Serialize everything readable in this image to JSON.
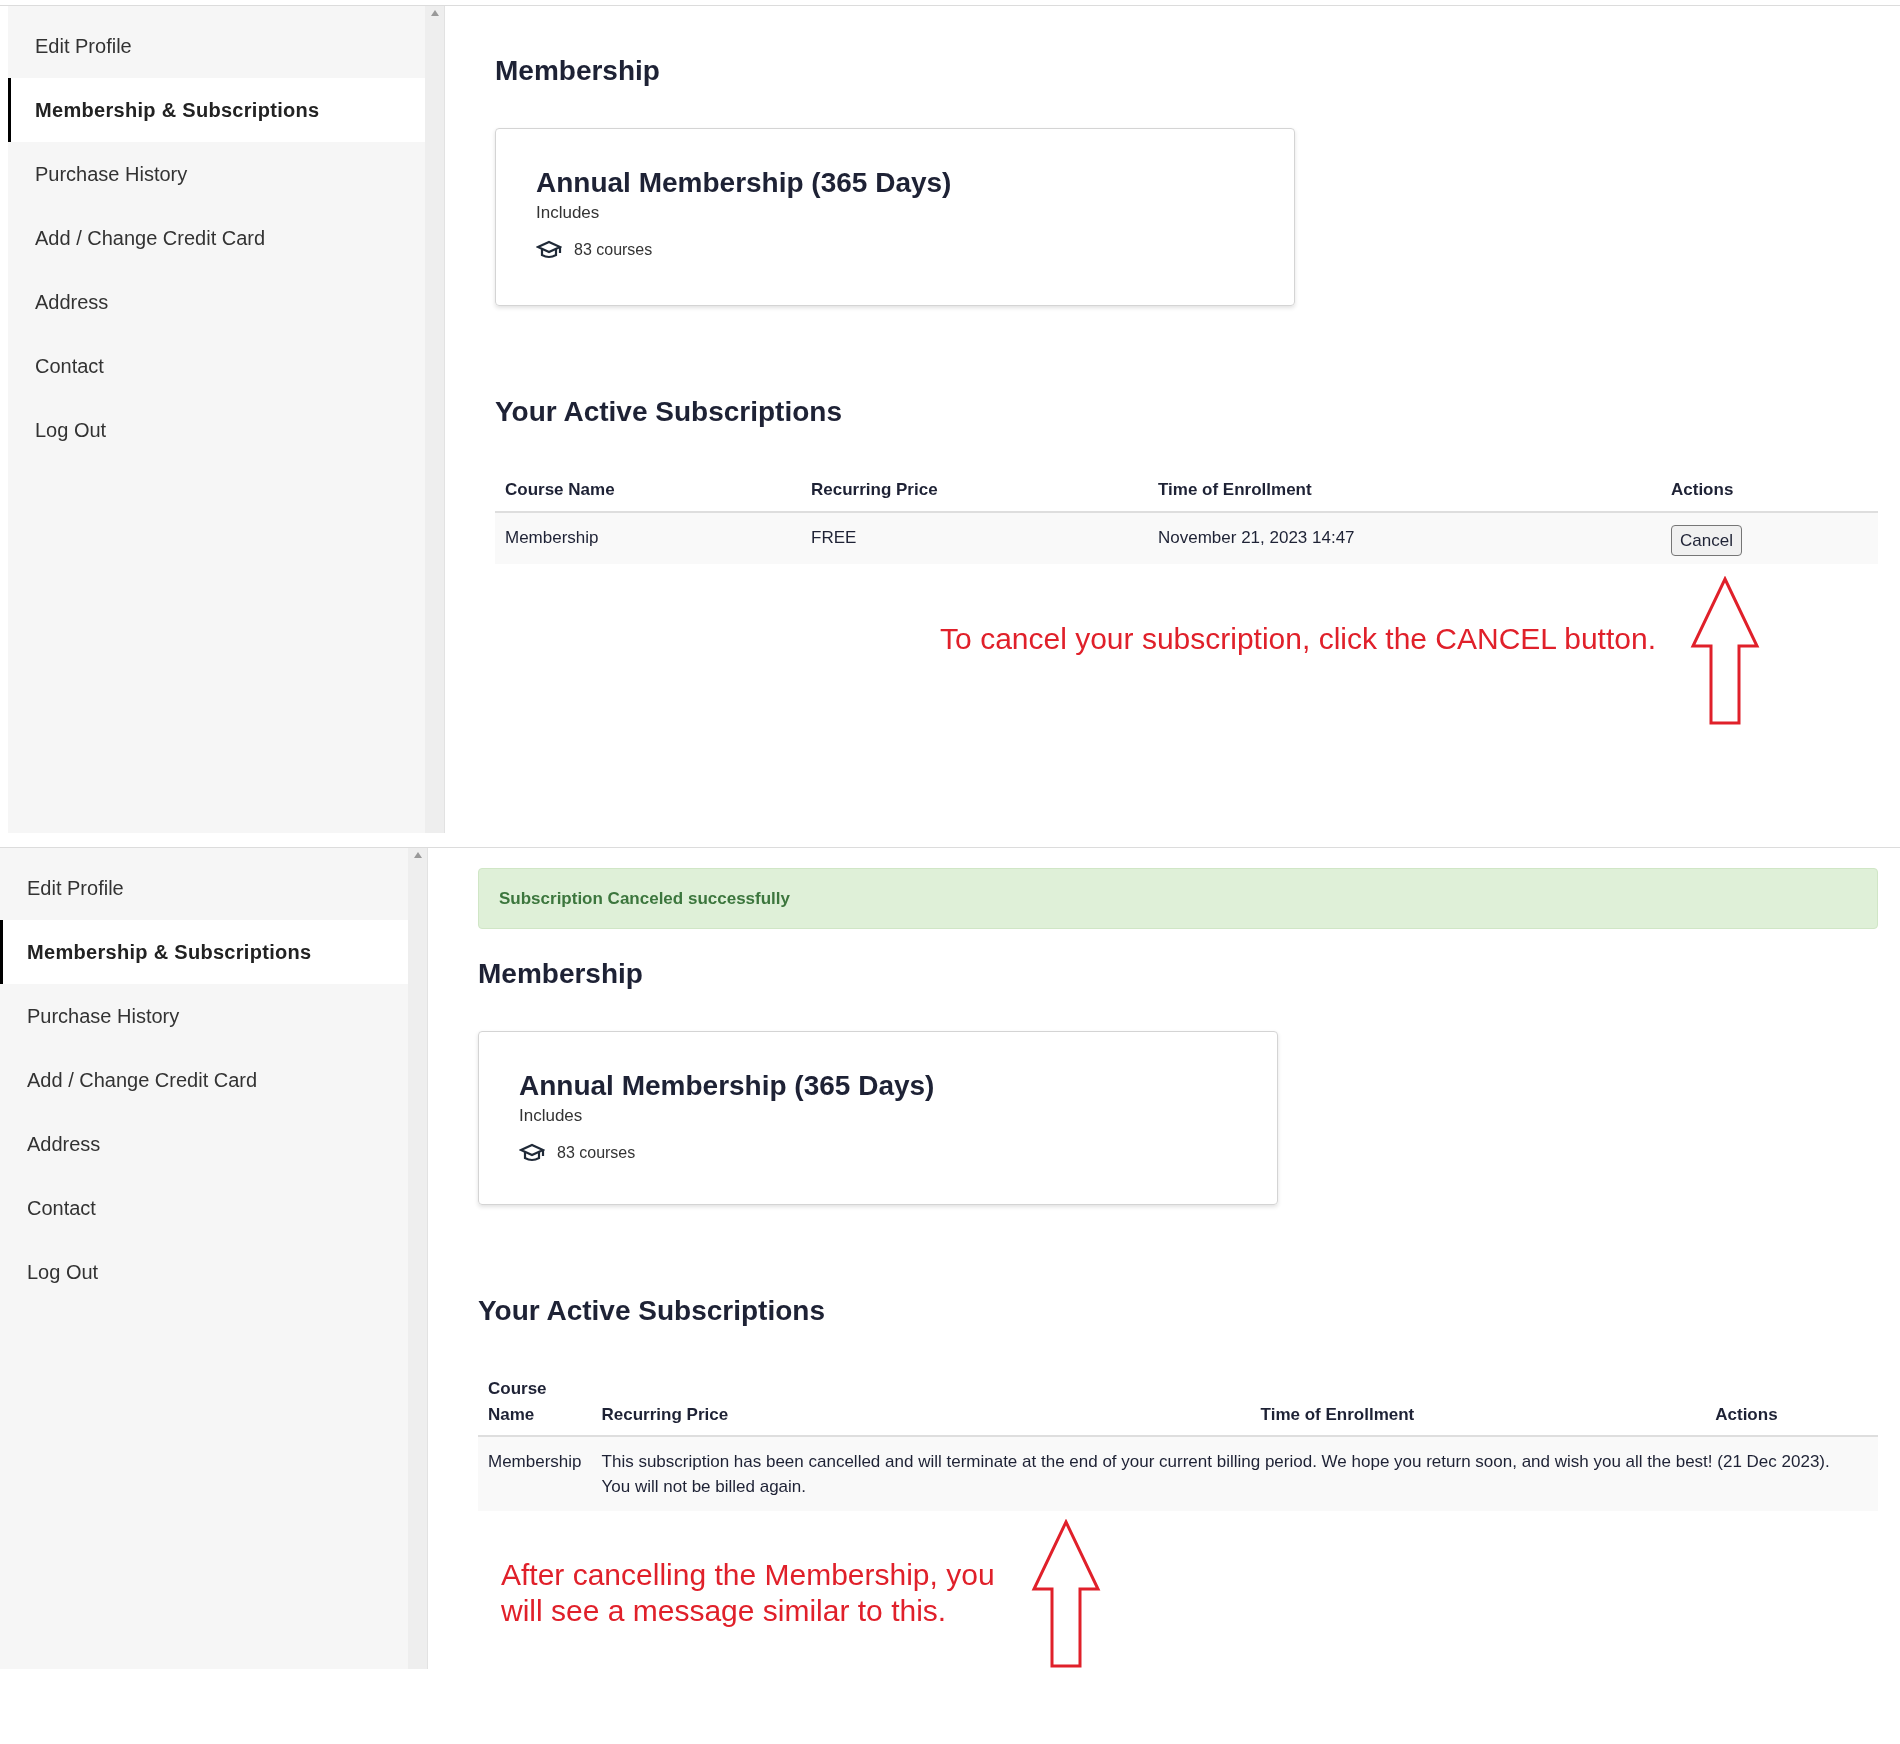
{
  "panels": [
    {
      "sidebar": {
        "items": [
          {
            "label": "Edit Profile",
            "selected": false
          },
          {
            "label": "Membership & Subscriptions",
            "selected": true
          },
          {
            "label": "Purchase History",
            "selected": false
          },
          {
            "label": "Add / Change Credit Card",
            "selected": false
          },
          {
            "label": "Address",
            "selected": false
          },
          {
            "label": "Contact",
            "selected": false
          },
          {
            "label": "Log Out",
            "selected": false
          }
        ]
      },
      "heading": "Membership",
      "card": {
        "title": "Annual Membership (365 Days)",
        "subtitle": "Includes",
        "courses": "83 courses"
      },
      "subscriptions": {
        "heading": "Your Active Subscriptions",
        "columns": [
          "Course Name",
          "Recurring Price",
          "Time of Enrollment",
          "Actions"
        ],
        "rows": [
          {
            "kind": "active",
            "course": "Membership",
            "price": "FREE",
            "time": "November 21, 2023 14:47",
            "action": "Cancel"
          }
        ]
      },
      "annotation": {
        "kind": "right",
        "text": "To cancel your subscription, click the CANCEL button."
      }
    },
    {
      "sidebar": {
        "items": [
          {
            "label": "Edit Profile",
            "selected": false
          },
          {
            "label": "Membership & Subscriptions",
            "selected": true
          },
          {
            "label": "Purchase History",
            "selected": false
          },
          {
            "label": "Add / Change Credit Card",
            "selected": false
          },
          {
            "label": "Address",
            "selected": false
          },
          {
            "label": "Contact",
            "selected": false
          },
          {
            "label": "Log Out",
            "selected": false
          }
        ]
      },
      "alert": "Subscription Canceled successfully",
      "heading": "Membership",
      "card": {
        "title": "Annual Membership (365 Days)",
        "subtitle": "Includes",
        "courses": "83 courses"
      },
      "subscriptions": {
        "heading": "Your Active Subscriptions",
        "columns": [
          "Course Name",
          "Recurring Price",
          "Time of Enrollment",
          "Actions"
        ],
        "rows": [
          {
            "kind": "cancelled",
            "course": "Membership",
            "message": "This subscription has been cancelled and will terminate at the end of your current billing period. We hope you return soon, and wish you all the best! (21 Dec 2023).",
            "note": "You will not be billed again."
          }
        ]
      },
      "annotation": {
        "kind": "left",
        "text": "After cancelling the Membership, you will see a message similar to this."
      }
    }
  ]
}
